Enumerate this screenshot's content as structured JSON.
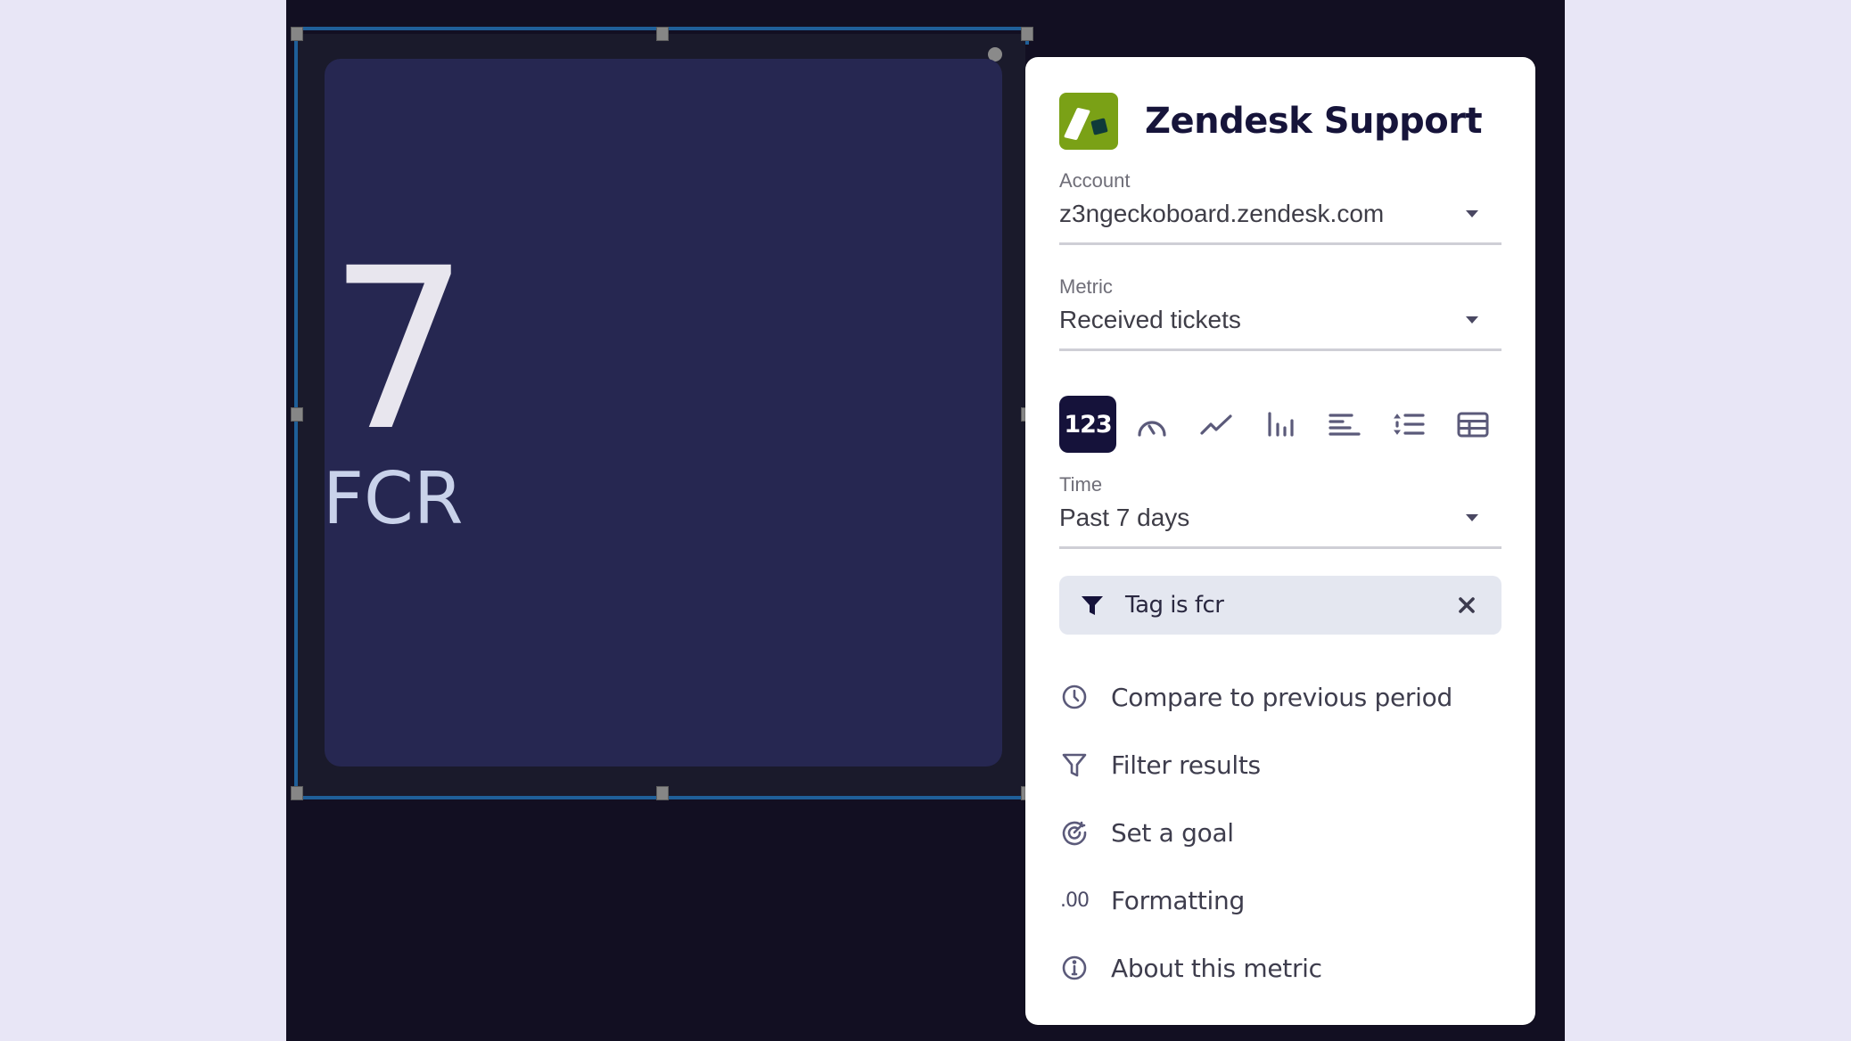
{
  "widget": {
    "value": "7",
    "title": "FCR"
  },
  "panel": {
    "integration_name": "Zendesk Support",
    "logo_icon": "zendesk-logo",
    "fields": {
      "account": {
        "label": "Account",
        "value": "z3ngeckoboard.zendesk.com"
      },
      "metric": {
        "label": "Metric",
        "value": "Received tickets"
      },
      "time": {
        "label": "Time",
        "value": "Past 7 days"
      }
    },
    "visualizations": [
      {
        "id": "number",
        "label": "123",
        "icon": "number-icon",
        "active": true
      },
      {
        "id": "gauge",
        "icon": "gauge-icon",
        "active": false
      },
      {
        "id": "line",
        "icon": "line-chart-icon",
        "active": false
      },
      {
        "id": "column",
        "icon": "column-chart-icon",
        "active": false
      },
      {
        "id": "bar",
        "icon": "bar-chart-icon",
        "active": false
      },
      {
        "id": "leaderboard",
        "icon": "leaderboard-icon",
        "active": false
      },
      {
        "id": "table",
        "icon": "table-icon",
        "active": false
      }
    ],
    "filter_chip": {
      "text": "Tag is fcr",
      "icon": "filter-solid-icon",
      "remove_icon": "close-icon"
    },
    "options": [
      {
        "label": "Compare to previous period",
        "icon": "clock-icon"
      },
      {
        "label": "Filter results",
        "icon": "filter-outline-icon"
      },
      {
        "label": "Set a goal",
        "icon": "target-icon"
      },
      {
        "label": "Formatting",
        "icon": "decimal-format-icon",
        "glyph": ".00"
      },
      {
        "label": "About this metric",
        "icon": "info-icon"
      }
    ]
  },
  "colors": {
    "canvas_bg": "#120f22",
    "widget_bg": "#262751",
    "selection": "#1f5f99",
    "brand_green": "#7aa116",
    "active_viz": "#15123a",
    "chip_bg": "#e4e7f0",
    "outer_bg": "#e8e6f6"
  }
}
